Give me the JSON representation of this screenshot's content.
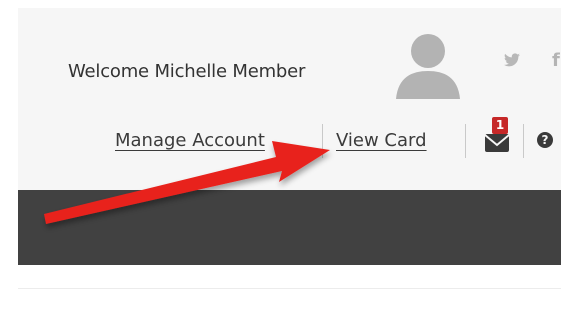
{
  "header": {
    "welcome_text": "Welcome Michelle Member",
    "social": {
      "twitter_glyph": "𝕪",
      "facebook_glyph": "f"
    },
    "links": {
      "manage_account": "Manage Account",
      "view_card": "View Card"
    },
    "mail_badge_count": "1",
    "help_glyph": "?"
  },
  "colors": {
    "nav_background": "#414141",
    "header_background": "#f6f6f6",
    "badge": "#c62828",
    "annotation_arrow": "#e8231d"
  },
  "icons": [
    "avatar-icon",
    "twitter-icon",
    "facebook-icon",
    "mail-icon",
    "help-icon",
    "annotation-arrow-icon"
  ]
}
